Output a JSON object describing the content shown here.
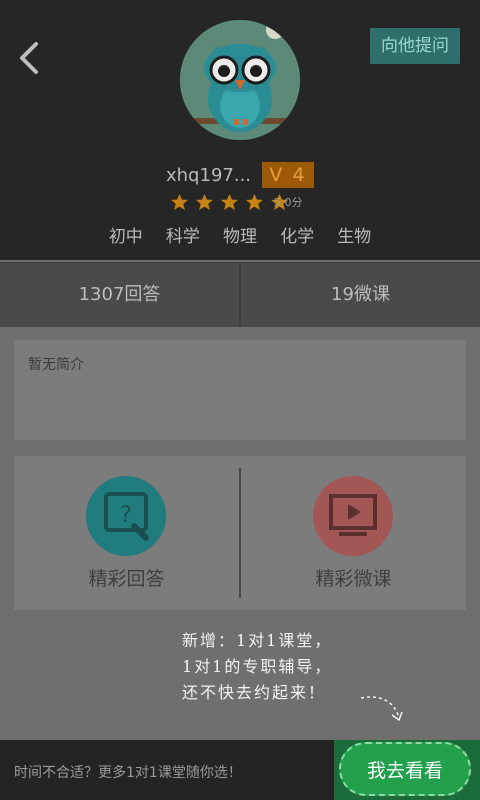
{
  "header": {
    "ask_label": "向他提问",
    "username": "xhq197...",
    "level": "V 4",
    "rating": 5.0,
    "rating_text": "5.0分",
    "subjects": [
      "初中",
      "科学",
      "物理",
      "化学",
      "生物"
    ]
  },
  "stats": {
    "answers": "1307回答",
    "lessons": "19微课"
  },
  "intro": {
    "text": "暂无简介"
  },
  "features": {
    "answers_label": "精彩回答",
    "lessons_label": "精彩微课"
  },
  "promo": {
    "lines": [
      "新增：1对1课堂，",
      "1对1的专职辅导，",
      "还不快去约起来！"
    ]
  },
  "bottom": {
    "text": "时间不合适？更多1对1课堂随你选！",
    "button_label": "我去看看"
  },
  "colors": {
    "teal": "#217d7d",
    "red": "#a25754",
    "green": "#22a04c",
    "badge": "#9c5a08",
    "star": "#c78312"
  },
  "icons": [
    "back-arrow-icon",
    "owl-avatar",
    "star-icon",
    "question-search-icon",
    "video-play-icon",
    "dashed-arrow-icon"
  ]
}
